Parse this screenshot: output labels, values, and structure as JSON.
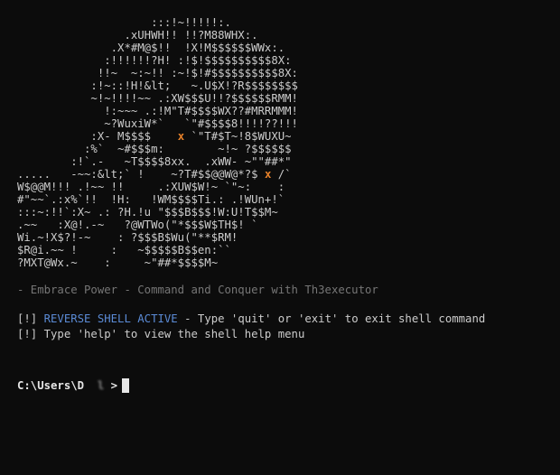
{
  "banner": {
    "line_01": "                    :::!~!!!!!:.",
    "line_02": "                .xUHWH!! !!?M88WHX:.",
    "line_03": "              .X*#M@$!!  !X!M$$$$$$WWx:.",
    "line_04": "             :!!!!!!?H! :!$!$$$$$$$$$$8X:",
    "line_05": "            !!~  ~:~!! :~!$!#$$$$$$$$$$8X:",
    "line_06": "           :!~::!H!&lt;   ~.U$X!?R$$$$$$$$",
    "line_07": "           ~!~!!!!~~ .:XW$$$U!!?$$$$$$RMM!",
    "line_08": "             !:~~~ .:!M\"T#$$$$WX??#MRRMMM!",
    "line_09": "             ~?WuxiW*`   `\"#$$$$8!!!!??!!!",
    "line_10a": "           :X- M$$$$    ",
    "line_10_mark": "x",
    "line_10b": " `\"T#$T~!8$WUXU~",
    "line_11": "          :%`  ~#$$$m:        ~!~ ?$$$$$$",
    "line_12": "        :!`.-   ~T$$$$8xx.  .xWW- ~\"\"##*\"",
    "line_13a": ".....   -~~:&lt;` !    ~?T#$$@@W@*?$ ",
    "line_13_mark": "x",
    "line_13b": " /`",
    "line_14": "W$@@M!!! .!~~ !!     .:XUW$W!~ `\"~:    :",
    "line_15": "#\"~~`.:x%`!!  !H:   !WM$$$$Ti.: .!WUn+!`",
    "line_16": ":::~:!!`:X~ .: ?H.!u \"$$$B$$$!W:U!T$$M~",
    "line_17": ".~~   :X@!.-~   ?@WTWo(\"*$$$W$TH$! `",
    "line_18": "Wi.~!X$?!-~    : ?$$$B$Wu(\"**$RM!",
    "line_19": "$R@i.~~ !     :   ~$$$$$B$$en:``",
    "line_20": "?MXT@Wx.~    :     ~\"##*$$$$M~"
  },
  "tagline": "- Embrace Power - Command and Conquer with Th3executor",
  "messages": {
    "line1_prefix": "[!] ",
    "line1_highlight": "REVERSE SHELL ACTIVE",
    "line1_rest": " - Type 'quit' or 'exit' to exit shell command",
    "line2": "[!] Type 'help' to view the shell help menu"
  },
  "prompt": {
    "path_prefix": "C:\\Users\\D",
    "masked_username": "  l",
    "suffix": " >"
  },
  "colors": {
    "background": "#0c0c0c",
    "foreground": "#cccccc",
    "accent_mark": "#e8822a",
    "highlight": "#5b8bd6",
    "dim": "#767676"
  }
}
